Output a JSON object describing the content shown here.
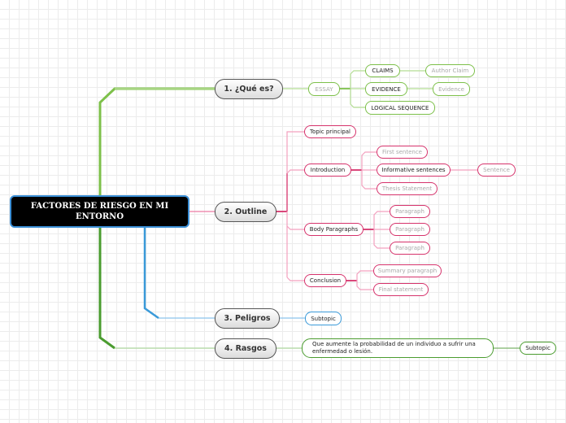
{
  "root": {
    "label": "FACTORES DE RIESGO EN MI ENTORNO"
  },
  "colors": {
    "green_branch": "#7dc04a",
    "pink_branch": "#d6336c",
    "blue_branch": "#3a9ad9",
    "dark_green_branch": "#4a9c2f",
    "root_fill": "#000000",
    "root_border": "#3b8fd6"
  },
  "topics": [
    {
      "label": "1. ¿Qué es?",
      "children": [
        {
          "label": "ESSAY",
          "children": [
            {
              "label": "CLAIMS",
              "children": [
                {
                  "label": "Author Claim"
                }
              ]
            },
            {
              "label": "EVIDENCE",
              "children": [
                {
                  "label": "Evidence"
                }
              ]
            },
            {
              "label": "LOGICAL SEQUENCE"
            }
          ]
        }
      ]
    },
    {
      "label": "2. Outline",
      "children": [
        {
          "label": "Topic principal"
        },
        {
          "label": "Introduction",
          "children": [
            {
              "label": "First sentence"
            },
            {
              "label": "Informative sentences",
              "children": [
                {
                  "label": "Sentence"
                }
              ]
            },
            {
              "label": "Thesis Statement"
            }
          ]
        },
        {
          "label": "Body Paragraphs",
          "children": [
            {
              "label": "Paragraph"
            },
            {
              "label": "Paragraph"
            },
            {
              "label": "Paragraph"
            }
          ]
        },
        {
          "label": "Conclusion",
          "children": [
            {
              "label": "Summary paragraph"
            },
            {
              "label": "Final statement"
            }
          ]
        }
      ]
    },
    {
      "label": "3. Peligros",
      "children": [
        {
          "label": "Subtopic"
        }
      ]
    },
    {
      "label": "4. Rasgos",
      "children": [
        {
          "label": "Que aumente la probabilidad de un individuo a sufrir una enfermedad o lesión.",
          "children": [
            {
              "label": "Subtopic"
            }
          ]
        }
      ]
    }
  ]
}
